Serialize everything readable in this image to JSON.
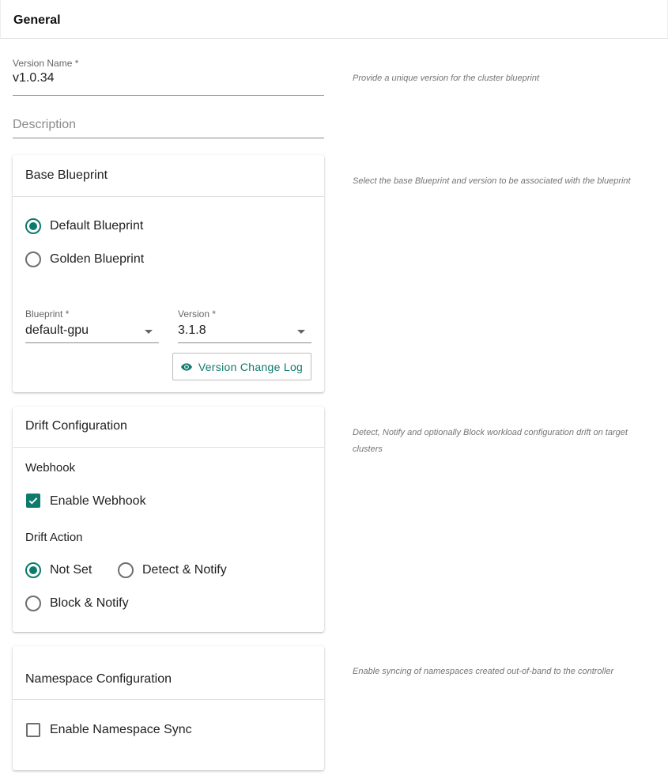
{
  "header": {
    "title": "General"
  },
  "version_name": {
    "label": "Version Name *",
    "value": "v1.0.34",
    "hint": "Provide a unique version for the cluster blueprint"
  },
  "description": {
    "placeholder": "Description"
  },
  "base_blueprint": {
    "title": "Base Blueprint",
    "hint": "Select the base Blueprint and version to be associated with the blueprint",
    "options": [
      {
        "label": "Default Blueprint",
        "selected": true
      },
      {
        "label": "Golden Blueprint",
        "selected": false
      }
    ],
    "blueprint": {
      "label": "Blueprint *",
      "value": "default-gpu"
    },
    "version": {
      "label": "Version *",
      "value": "3.1.8"
    },
    "change_log_button": "Version Change Log"
  },
  "drift": {
    "title": "Drift Configuration",
    "hint": "Detect, Notify and optionally Block workload configuration drift on target clusters",
    "webhook_label": "Webhook",
    "enable_webhook": {
      "label": "Enable Webhook",
      "checked": true
    },
    "action_label": "Drift Action",
    "actions": [
      {
        "label": "Not Set",
        "selected": true
      },
      {
        "label": "Detect & Notify",
        "selected": false
      },
      {
        "label": "Block & Notify",
        "selected": false
      }
    ]
  },
  "namespace": {
    "title": "Namespace Configuration",
    "hint": "Enable syncing of namespaces created out-of-band to the controller",
    "enable_sync": {
      "label": "Enable Namespace Sync",
      "checked": false
    }
  },
  "colors": {
    "accent": "#0d7a6b",
    "border": "#e0e0e0",
    "hint": "#757575"
  }
}
